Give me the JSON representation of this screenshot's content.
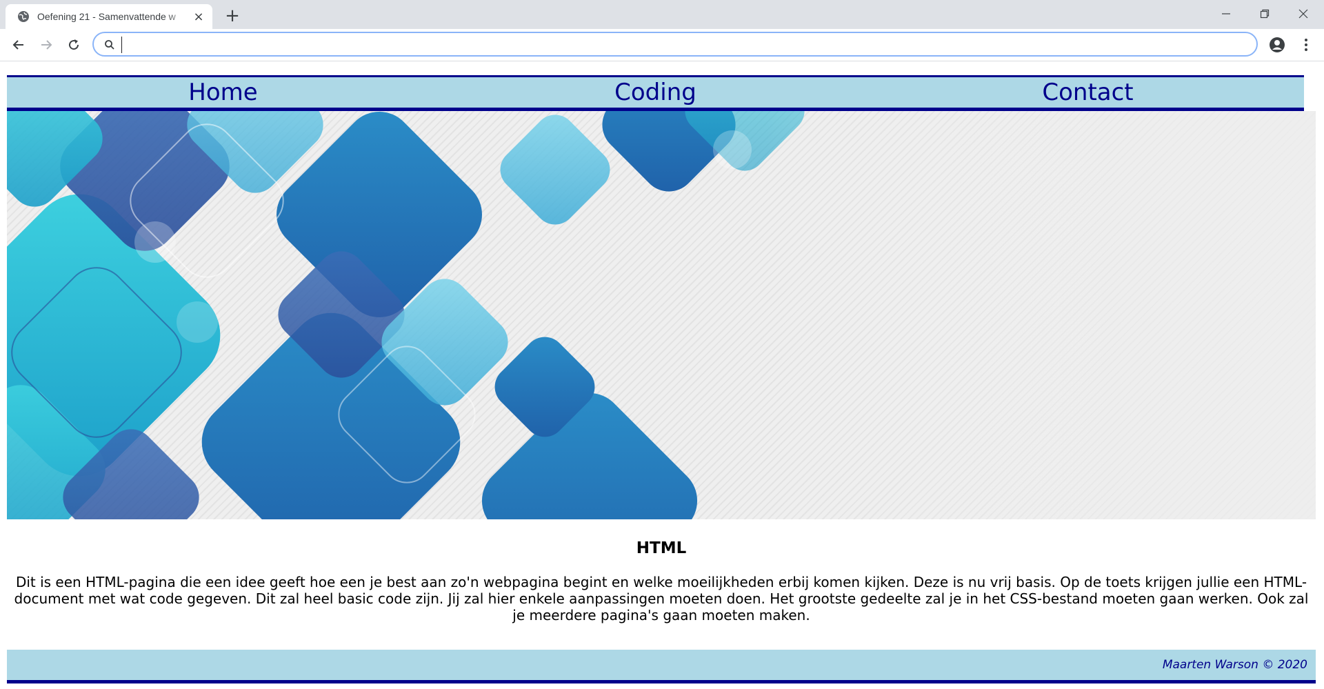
{
  "browser": {
    "tab": {
      "title": "Oefening 21 - Samenvattende w",
      "favicon": "globe-icon",
      "close": "×"
    },
    "new_tab": "+",
    "window_controls": [
      "minimize-icon",
      "restore-icon",
      "close-icon"
    ],
    "toolbar": {
      "back": "back-arrow-icon",
      "forward": "forward-arrow-icon",
      "reload": "reload-icon",
      "omnibox_value": "",
      "profile": "profile-icon",
      "menu": "kebab-menu-icon"
    }
  },
  "site": {
    "nav": [
      {
        "label": "Home"
      },
      {
        "label": "Coding"
      },
      {
        "label": "Contact"
      }
    ],
    "hero_image": "abstract blue rounded squares banner",
    "content": {
      "title": "HTML",
      "text": "Dit is een HTML-pagina die een idee geeft hoe een je best aan zo'n webpagina begint en welke moeilijkheden erbij komen kijken. Deze is nu vrij basis. Op de toets krijgen jullie een HTML-document met wat code gegeven. Dit zal heel basic code zijn. Jij zal hier enkele aanpassingen moeten doen. Het grootste gedeelte zal je in het CSS-bestand moeten gaan werken. Ook zal je meerdere pagina's gaan moeten maken."
    },
    "footer": "Maarten Warson © 2020"
  },
  "colors": {
    "nav_bg": "#add8e6",
    "accent": "#00008b",
    "tab_strip": "#dee1e6",
    "focus_ring": "#8ab4f8"
  }
}
